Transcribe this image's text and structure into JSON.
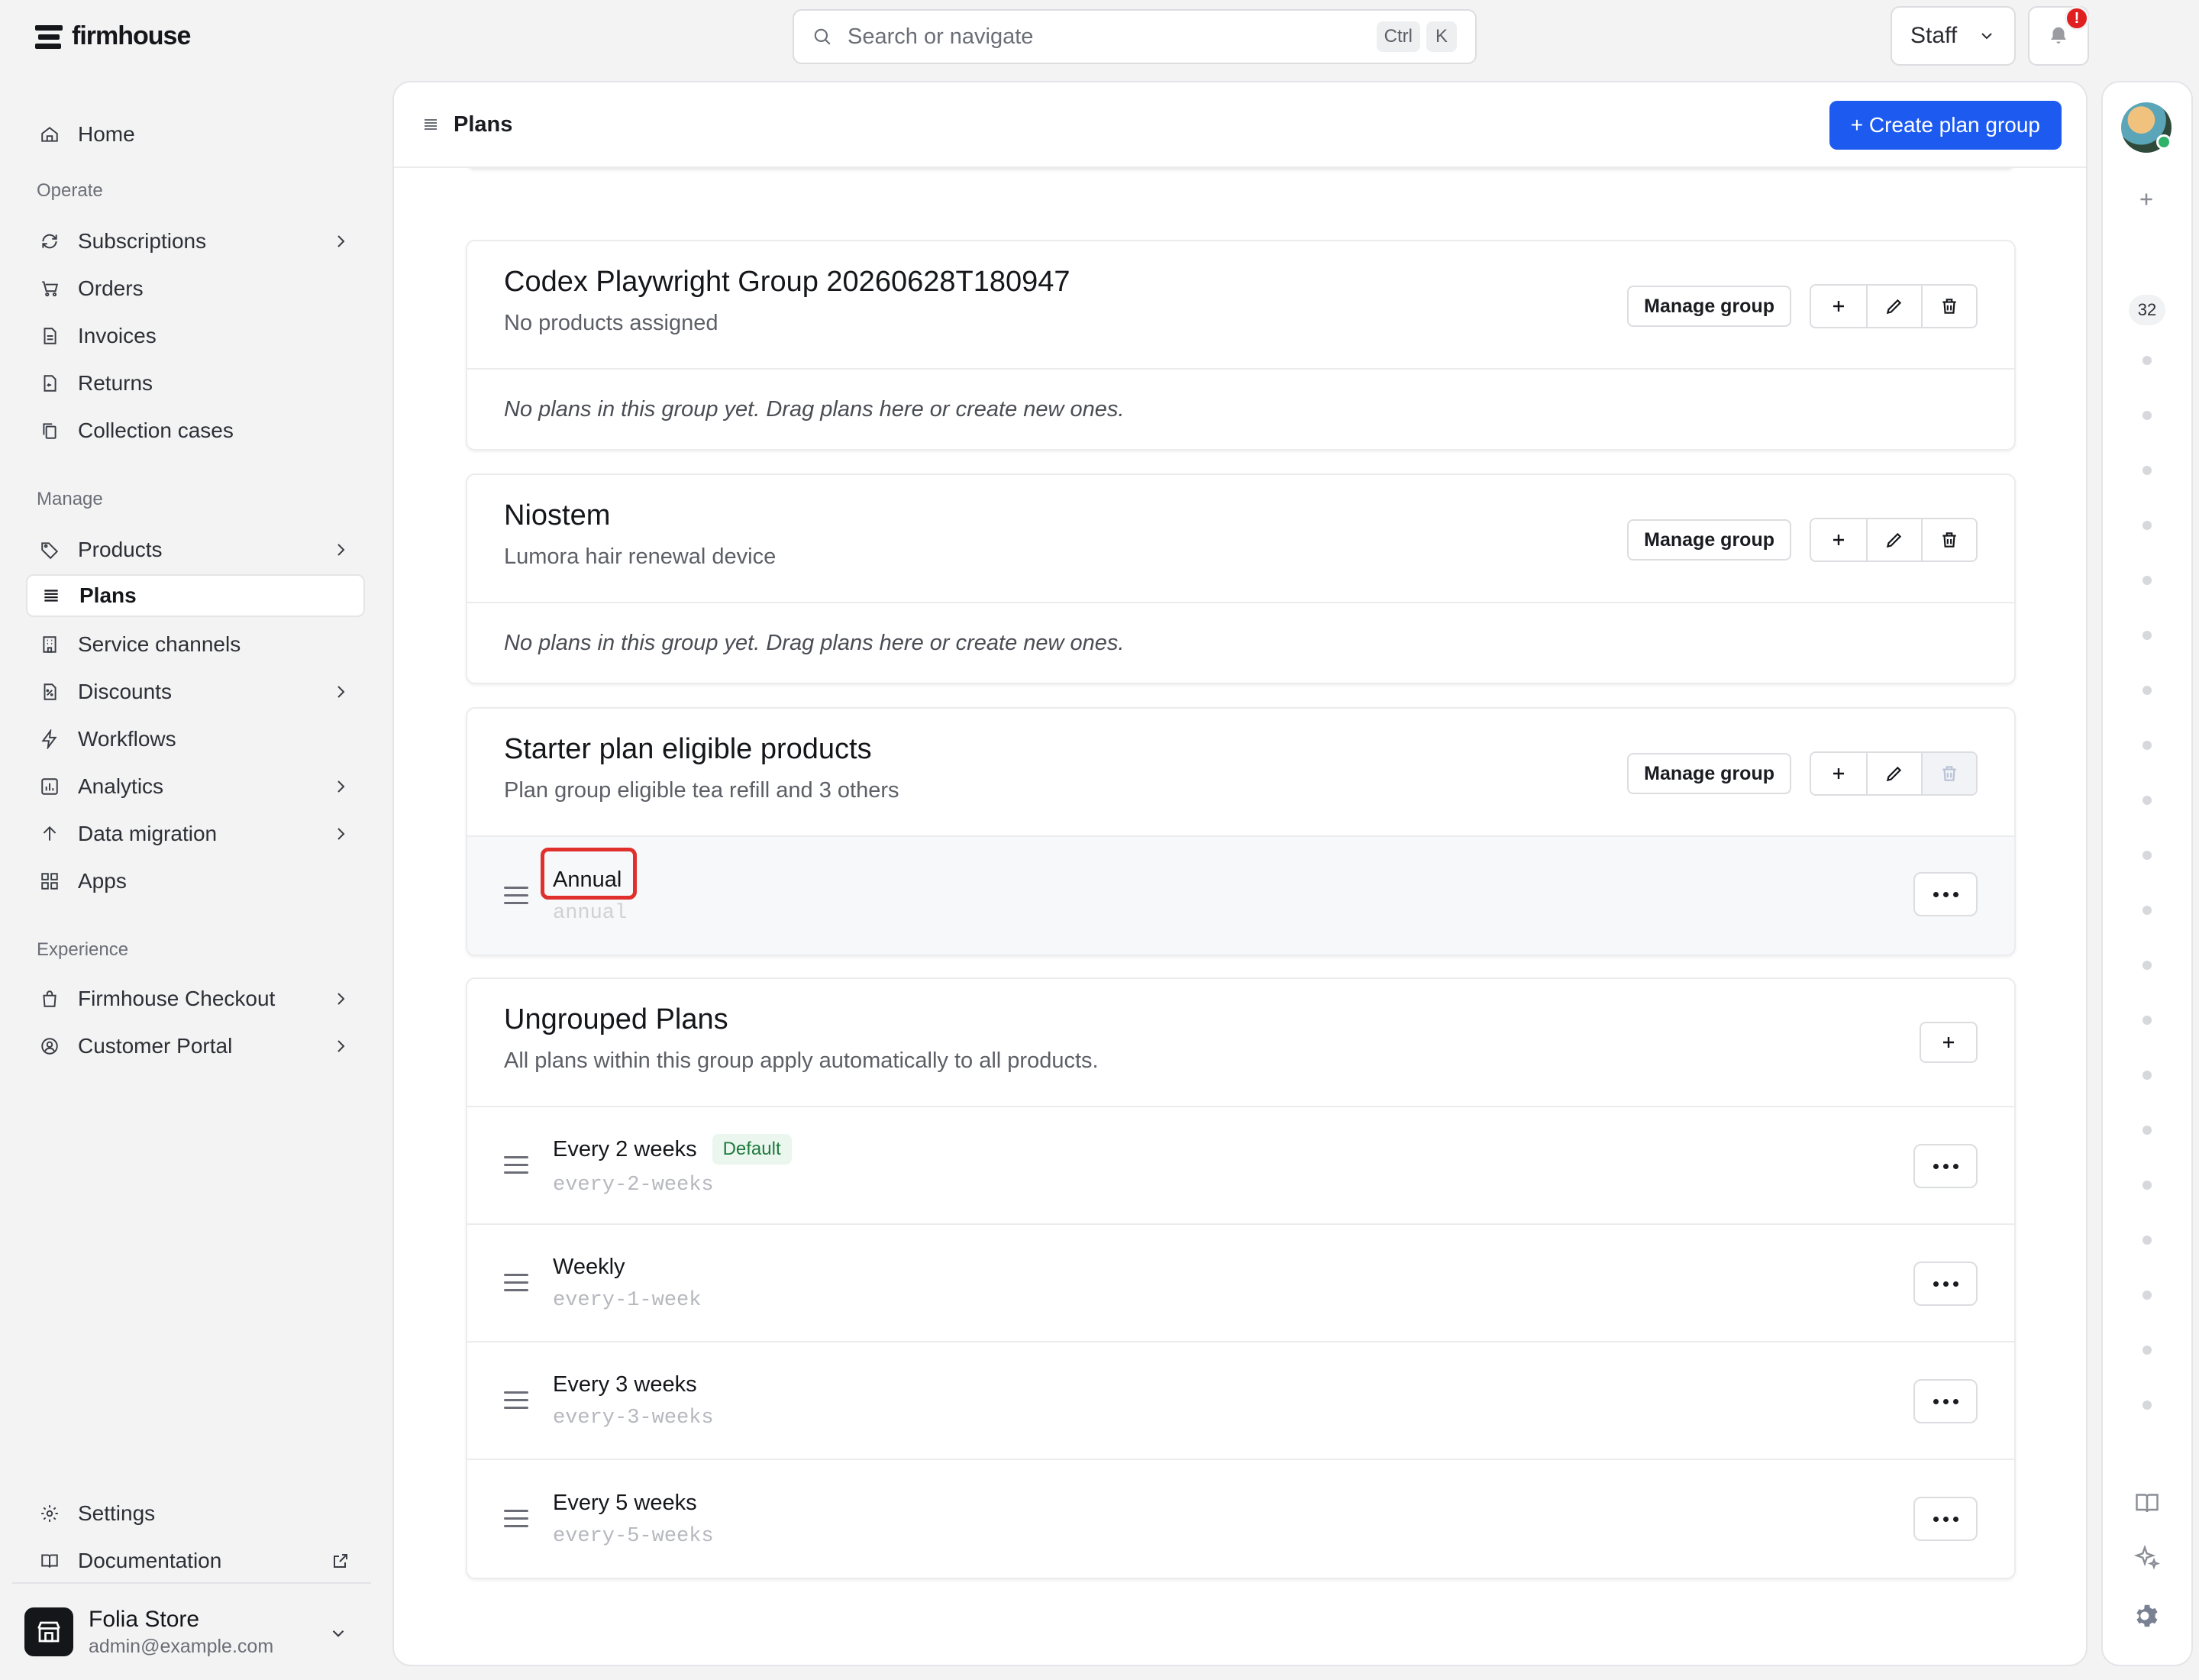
{
  "app": {
    "brand": "firmhouse"
  },
  "search": {
    "placeholder": "Search or navigate",
    "kbd_ctrl": "Ctrl",
    "kbd_k": "K"
  },
  "topbar": {
    "staff_label": "Staff",
    "notification_badge": "!"
  },
  "sidebar": {
    "home": "Home",
    "section_operate": "Operate",
    "subscriptions": "Subscriptions",
    "orders": "Orders",
    "invoices": "Invoices",
    "returns": "Returns",
    "collection_cases": "Collection cases",
    "section_manage": "Manage",
    "products": "Products",
    "plans": "Plans",
    "service_channels": "Service channels",
    "discounts": "Discounts",
    "workflows": "Workflows",
    "analytics": "Analytics",
    "data_migration": "Data migration",
    "apps": "Apps",
    "section_experience": "Experience",
    "firmhouse_checkout": "Firmhouse Checkout",
    "customer_portal": "Customer Portal",
    "settings": "Settings",
    "documentation": "Documentation"
  },
  "account": {
    "name": "Folia Store",
    "email": "admin@example.com"
  },
  "main": {
    "title": "Plans",
    "create_button": "+ Create plan group",
    "empty_text": "No plans in this group yet. Drag plans here or create new ones.",
    "manage_group": "Manage group",
    "groups": [
      {
        "title": "Codex Playwright Group 20260628T180947",
        "subtitle": "No products assigned"
      },
      {
        "title": "Niostem",
        "subtitle": "Lumora hair renewal device"
      },
      {
        "title": "Starter plan eligible products",
        "subtitle": "Plan group eligible tea refill and 3 others"
      }
    ],
    "starter_plan": {
      "name": "Annual",
      "slug": "annual"
    },
    "ungrouped": {
      "title": "Ungrouped Plans",
      "subtitle": "All plans within this group apply automatically to all products.",
      "plans": [
        {
          "name": "Every 2 weeks",
          "slug": "every-2-weeks",
          "badge": "Default"
        },
        {
          "name": "Weekly",
          "slug": "every-1-week"
        },
        {
          "name": "Every 3 weeks",
          "slug": "every-3-weeks"
        },
        {
          "name": "Every 5 weeks",
          "slug": "every-5-weeks"
        }
      ]
    }
  },
  "rail": {
    "count": "32"
  },
  "colors": {
    "accent": "#1d5bf0",
    "badge_green": "#1f7a3e",
    "focus_red": "#e0302e",
    "alert": "#e02020"
  }
}
